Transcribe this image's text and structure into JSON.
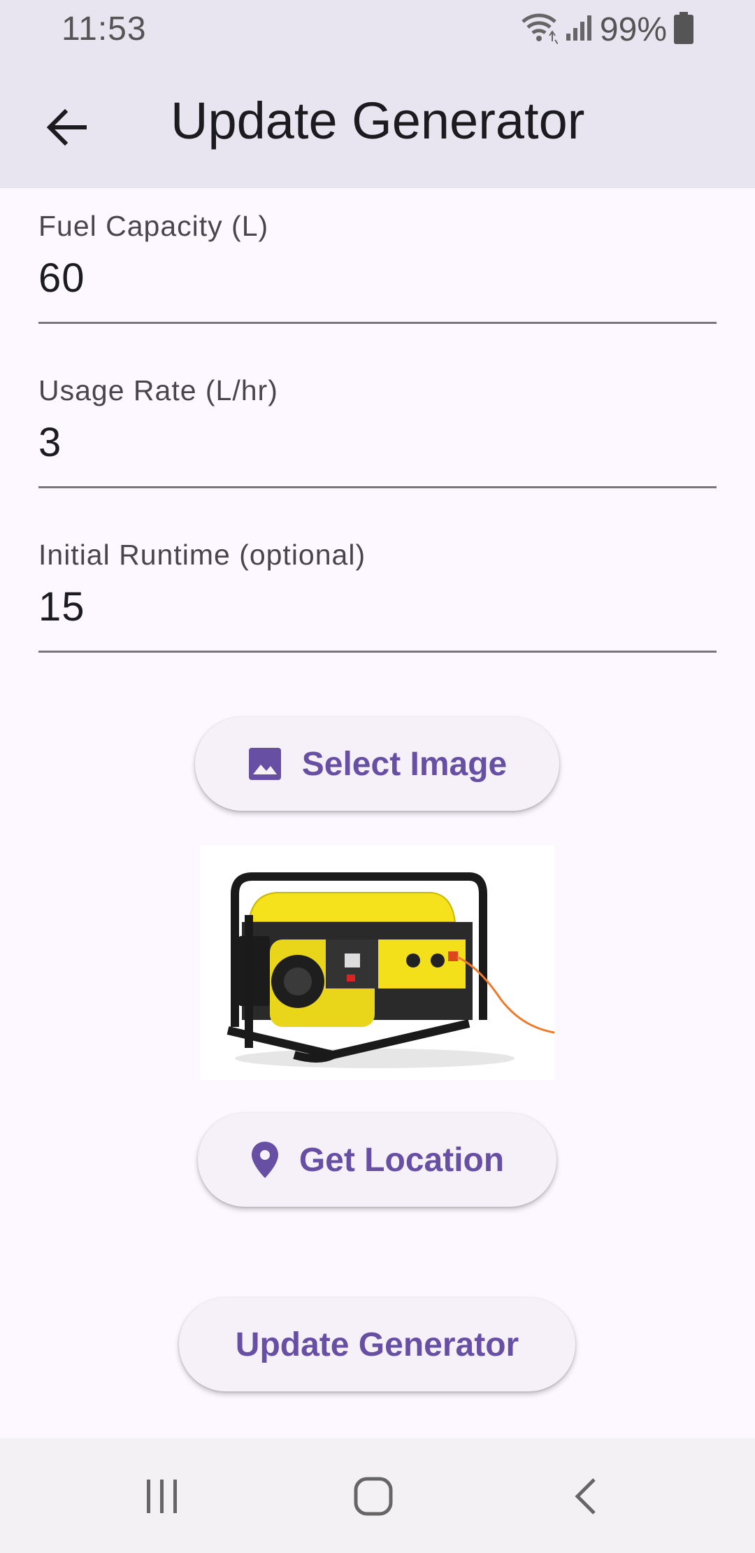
{
  "status_bar": {
    "time": "11:53",
    "battery": "99%",
    "icons": [
      "wifi-icon",
      "signal-icon",
      "battery-icon"
    ]
  },
  "app_bar": {
    "title": "Update Generator",
    "back_icon": "arrow-back-icon"
  },
  "form": {
    "fields": [
      {
        "label": "Fuel Capacity (L)",
        "value": "60"
      },
      {
        "label": "Usage Rate (L/hr)",
        "value": "3"
      },
      {
        "label": "Initial Runtime (optional)",
        "value": "15"
      }
    ]
  },
  "actions": {
    "select_image_label": "Select Image",
    "select_image_icon": "image-icon",
    "get_location_label": "Get Location",
    "get_location_icon": "location-pin-icon",
    "submit_label": "Update Generator"
  },
  "preview_image": {
    "subject": "generator-photo"
  },
  "nav_bar": {
    "icons": [
      "recent-apps-icon",
      "home-icon",
      "back-icon"
    ]
  },
  "colors": {
    "accent": "#6750a4",
    "app_bar_bg": "#e9e5f0",
    "page_bg": "#fdf7ff",
    "button_bg": "#f6f1f8"
  }
}
